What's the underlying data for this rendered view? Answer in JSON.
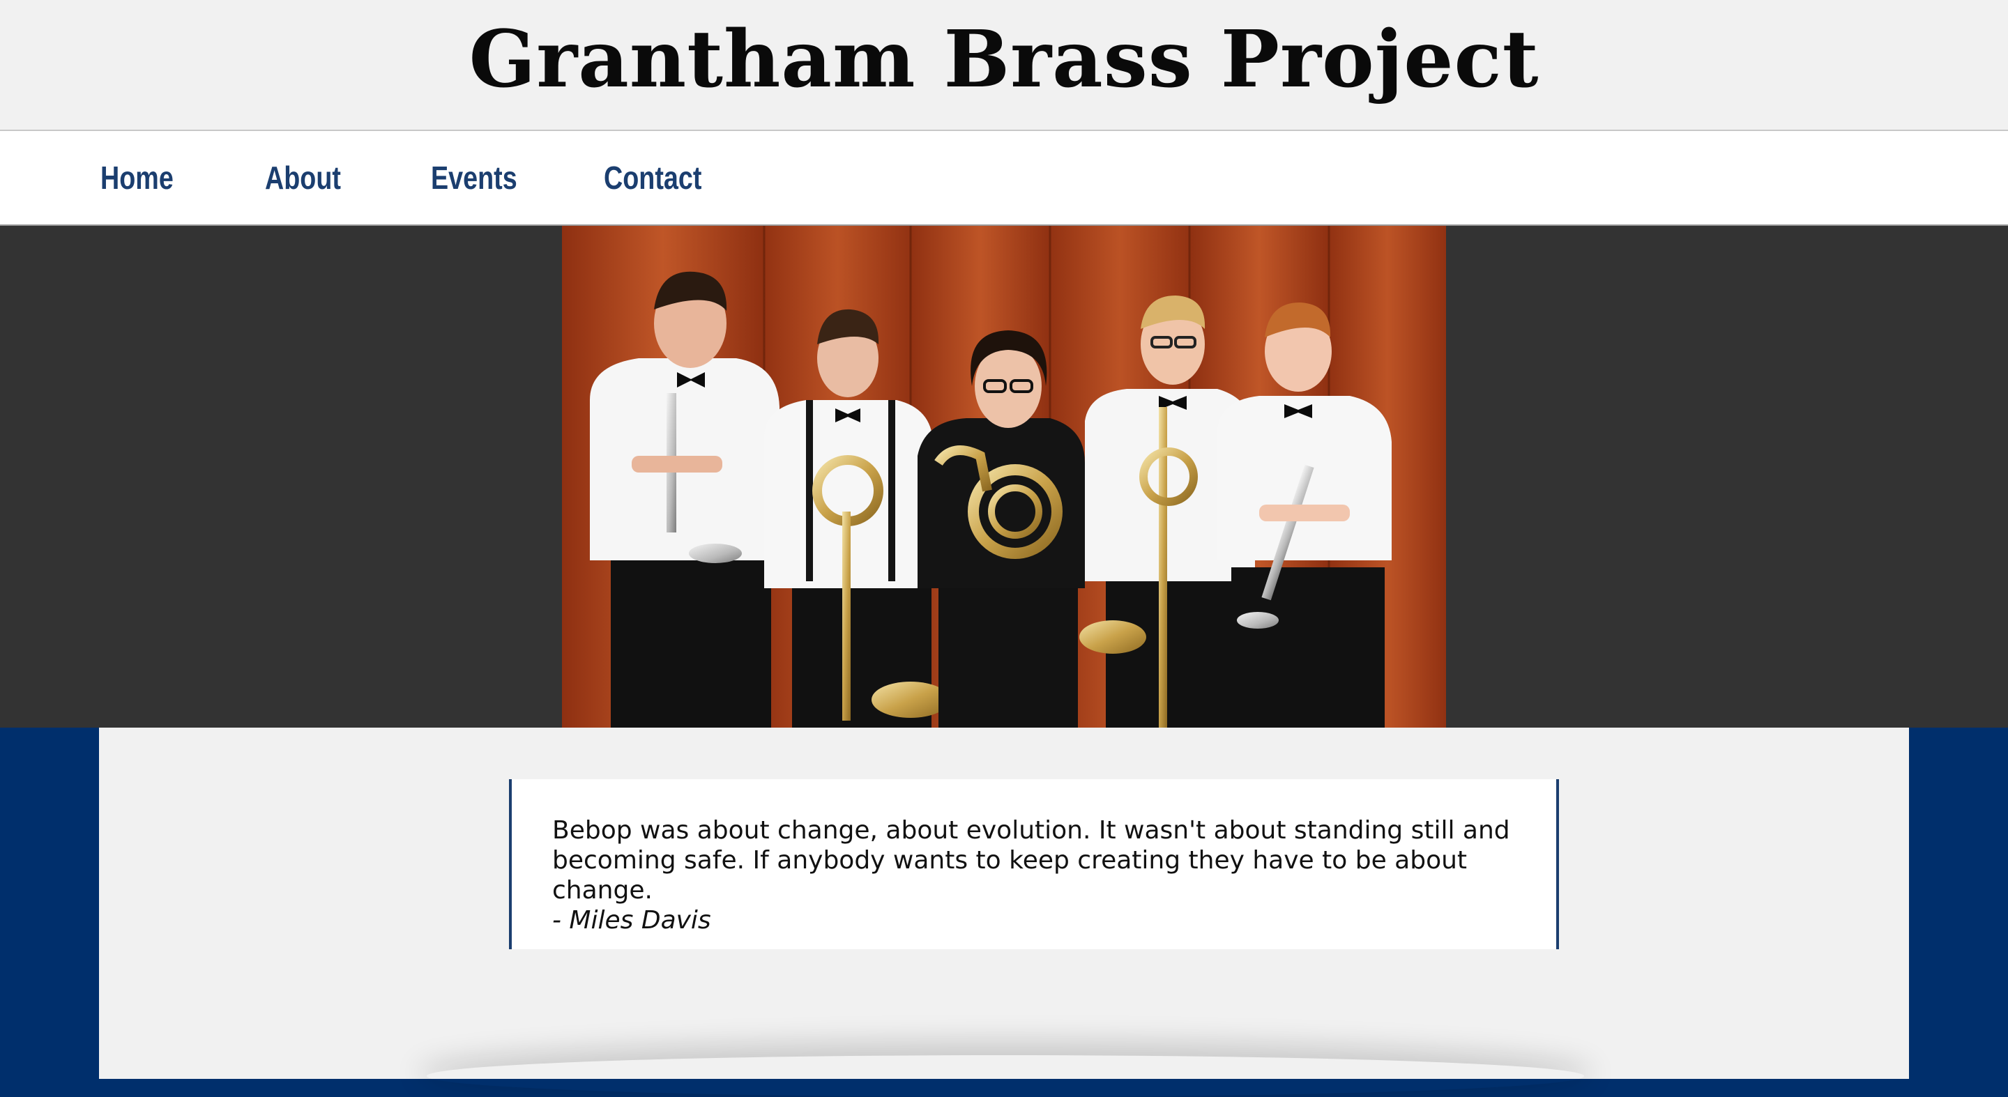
{
  "site": {
    "title": "Grantham Brass Project"
  },
  "nav": {
    "items": [
      {
        "label": "Home"
      },
      {
        "label": "About"
      },
      {
        "label": "Events"
      },
      {
        "label": "Contact"
      }
    ]
  },
  "hero": {
    "image": "brass-quintet-group-photo"
  },
  "quote": {
    "text": "Bebop was about change, about evolution. It wasn't about standing still and becoming safe. If anybody wants to keep creating they have to be about change.",
    "author": "- Miles Davis"
  },
  "colors": {
    "brand_navy": "#002f6c",
    "nav_link": "#1b3e6f",
    "header_bg": "#f1f1f1",
    "hero_bg": "#333333"
  }
}
